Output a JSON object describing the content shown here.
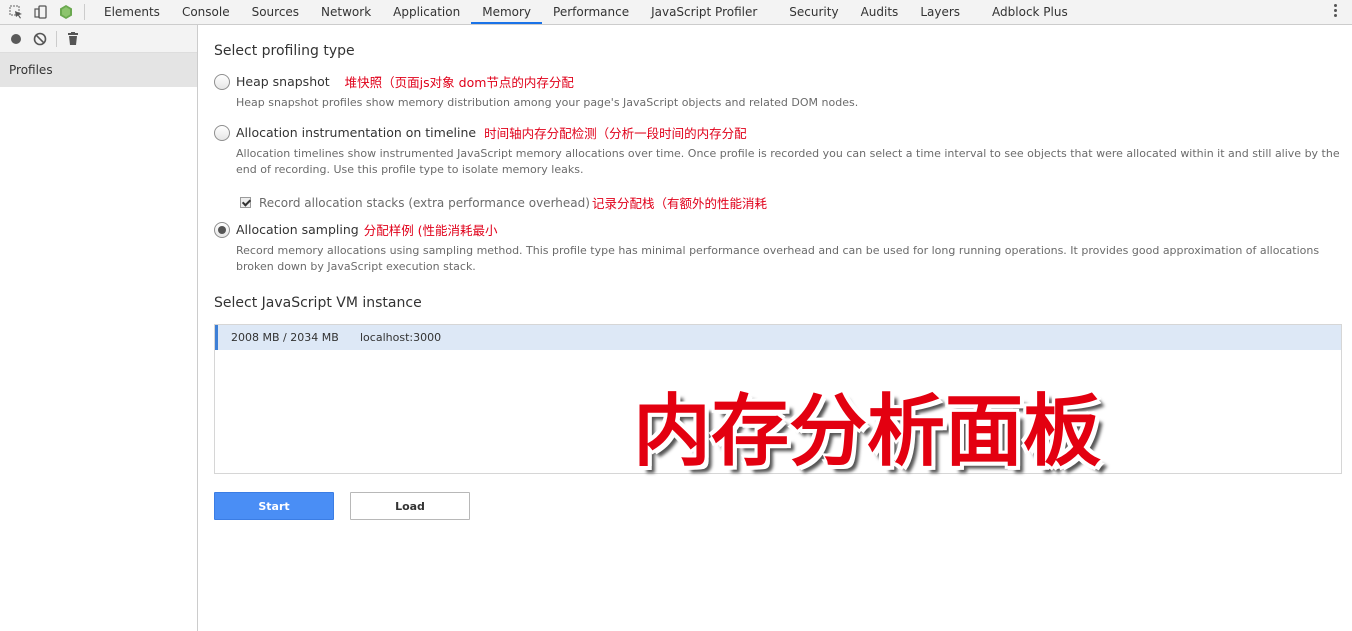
{
  "topbar": {
    "tabs": [
      "Elements",
      "Console",
      "Sources",
      "Network",
      "Application",
      "Memory",
      "Performance",
      "JavaScript Profiler",
      "Security",
      "Audits",
      "Layers",
      "Adblock Plus"
    ],
    "active_tab": "Memory"
  },
  "sidebar": {
    "profiles_label": "Profiles"
  },
  "main": {
    "profiling_title": "Select profiling type",
    "options": [
      {
        "label": "Heap snapshot",
        "annotation": "堆快照（页面js对象 dom节点的内存分配",
        "description": "Heap snapshot profiles show memory distribution among your page's JavaScript objects and related DOM nodes.",
        "checked": false
      },
      {
        "label": "Allocation instrumentation on timeline",
        "annotation": "时间轴内存分配检测（分析一段时间的内存分配",
        "description": "Allocation timelines show instrumented JavaScript memory allocations over time. Once profile is recorded you can select a time interval to see objects that were allocated within it and still alive by the end of recording. Use this profile type to isolate memory leaks.",
        "checked": false
      },
      {
        "label": "Allocation sampling",
        "annotation": "分配样例 (性能消耗最小",
        "description": "Record memory allocations using sampling method. This profile type has minimal performance overhead and can be used for long running operations. It provides good approximation of allocations broken down by JavaScript execution stack.",
        "checked": true
      }
    ],
    "record_stacks": {
      "label": "Record allocation stacks (extra performance overhead)",
      "annotation": "记录分配栈（有额外的性能消耗",
      "checked": true
    },
    "vm_title": "Select JavaScript VM instance",
    "vm_instances": [
      {
        "memory": "2008 MB / 2034 MB",
        "host": "localhost:3000"
      }
    ],
    "start_label": "Start",
    "load_label": "Load"
  },
  "overlay_title": "内存分析面板",
  "colors": {
    "accent": "#1a73e8",
    "annotation_red": "#e0001a",
    "start_button": "#4a8ef5",
    "vm_selected_bg": "#dde8f6"
  }
}
